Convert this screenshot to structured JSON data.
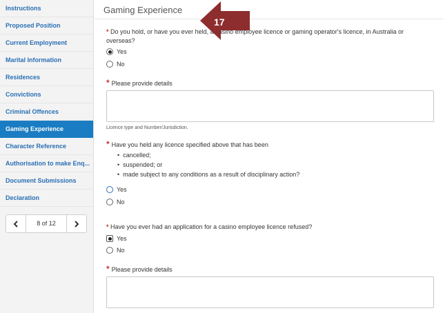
{
  "sidebar": {
    "items": [
      {
        "label": "Instructions"
      },
      {
        "label": "Proposed Position"
      },
      {
        "label": "Current Employment"
      },
      {
        "label": "Marital Information"
      },
      {
        "label": "Residences"
      },
      {
        "label": "Convictions"
      },
      {
        "label": "Criminal Offences"
      },
      {
        "label": "Gaming Experience"
      },
      {
        "label": "Character Reference"
      },
      {
        "label": "Authorisation to make Enq..."
      },
      {
        "label": "Document Submissions"
      },
      {
        "label": "Declaration"
      }
    ],
    "active": "Gaming Experience",
    "pager": {
      "label": "8 of 12"
    }
  },
  "main": {
    "title": "Gaming Experience",
    "q1": {
      "text": "Do you hold, or have you ever held, a casino employee licence or gaming operator's licence, in Australia or overseas?",
      "yes": "Yes",
      "no": "No",
      "selected": "Yes"
    },
    "details1": {
      "label": "Please provide details",
      "value": "",
      "help": "Licence type and Number/Jurisdiction."
    },
    "q2": {
      "text": "Have you held any licence specified above that has been",
      "bullets": [
        "cancelled;",
        "suspended; or",
        "made subject to any conditions as a result of disciplinary action?"
      ],
      "yes": "Yes",
      "no": "No",
      "selected": ""
    },
    "q3": {
      "text": "Have you ever had an application for a casino employee licence refused?",
      "yes": "Yes",
      "no": "No",
      "selected": "Yes"
    },
    "details2": {
      "label": "Please provide details",
      "value": ""
    }
  },
  "callout": {
    "number": "17",
    "color": "#8e2d2d"
  },
  "colors": {
    "accent": "#1a7cc2",
    "link": "#2a6fb5",
    "required": "#c0392b"
  }
}
